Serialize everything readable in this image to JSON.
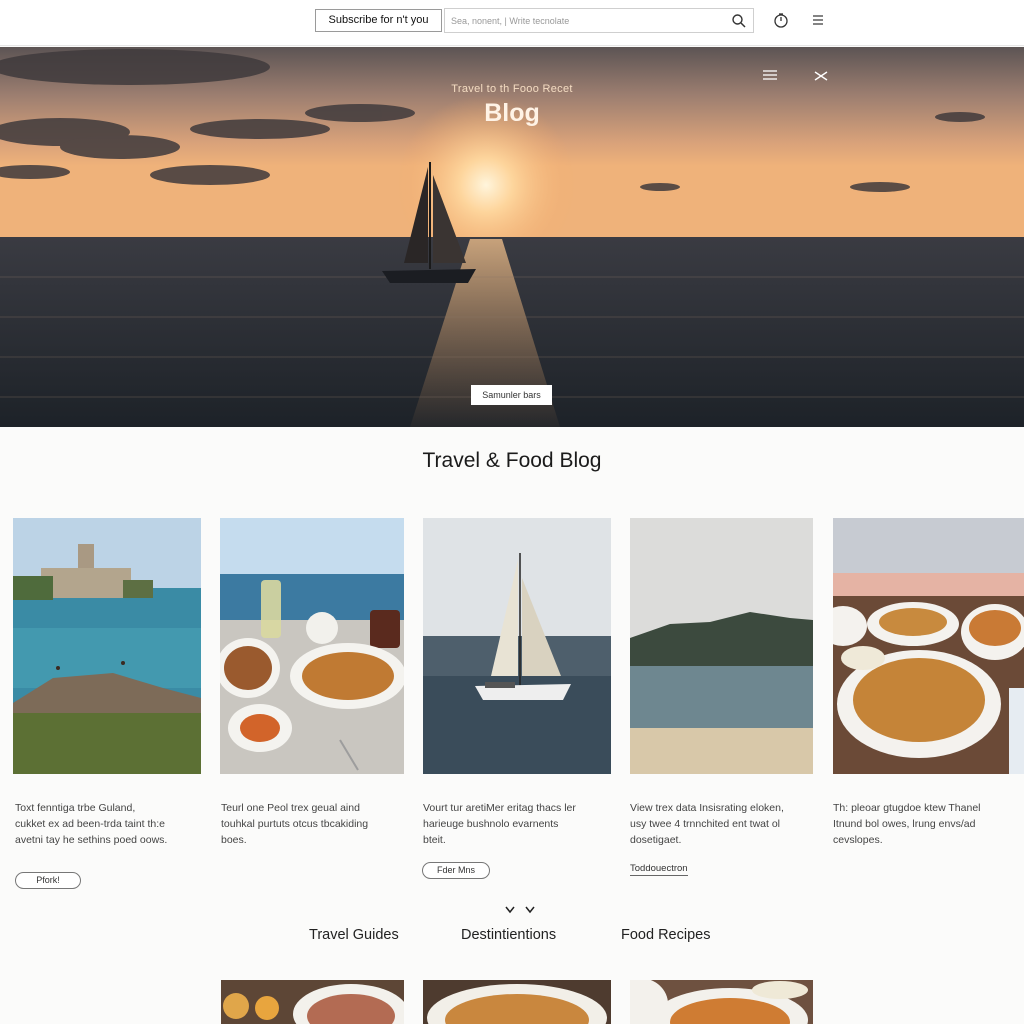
{
  "header": {
    "subscribe_label": "Subscribe for n't you",
    "search_placeholder": "Sea, nonent, | Write tecnolate"
  },
  "hero": {
    "kicker": "Travel to th Fooo Recet",
    "title": "Blog",
    "button_label": "Samunler bars"
  },
  "section": {
    "title": "Travel & Food Blog"
  },
  "cards": [
    {
      "image": "coastal-castle-photo",
      "lines": [
        "Toxt fenntiga trbe Guland,",
        "cukket ex ad been-trda taint th:e",
        "avetni tay he sethins poed oows."
      ],
      "action_type": "button",
      "action_label": "Pfork!"
    },
    {
      "image": "seaside-food-table-photo",
      "lines": [
        "Teurl one Peol trex geual aind",
        "touhkal purtuts otcus tbcakiding",
        "boes."
      ],
      "action_type": "",
      "action_label": ""
    },
    {
      "image": "sailboat-photo",
      "lines": [
        "Vourt tur aretiMer eritag thacs ler",
        "harieuge bushnolo evarnents",
        "bteit."
      ],
      "action_type": "button",
      "action_label": "Fder Mns"
    },
    {
      "image": "mountain-beach-photo",
      "lines": [
        "View trex data Insisrating eloken,",
        "usy twee 4 trnnchited ent twat ol",
        "dosetigaet."
      ],
      "action_type": "link",
      "action_label": "Toddouectron"
    },
    {
      "image": "seafood-dishes-photo",
      "lines": [
        "Th: pleoar gtugdoe ktew Thanel",
        "Itnund bol owes, lrung envs/ad",
        "cevslopes."
      ],
      "action_type": "",
      "action_label": ""
    }
  ],
  "categories": [
    "Travel Guides",
    "Destintientions",
    "Food Recipes"
  ],
  "colors": {
    "accent": "#f0a25a",
    "sea": "#2e3a44",
    "background": "#fbfbfa"
  }
}
